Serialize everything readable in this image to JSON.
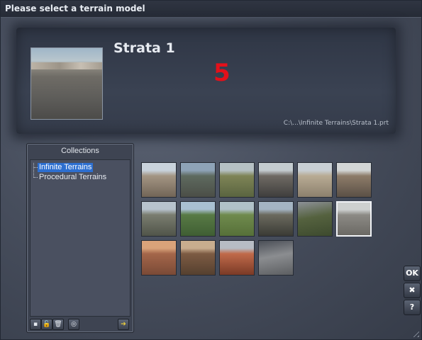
{
  "window": {
    "title": "Please select a terrain model"
  },
  "preview": {
    "name": "Strata 1",
    "count": "5",
    "path": "C:\\...\\Infinite Terrains\\Strata 1.prt"
  },
  "collections": {
    "header": "Collections",
    "items": [
      {
        "label": "Infinite Terrains",
        "selected": true
      },
      {
        "label": "Procedural Terrains",
        "selected": false
      }
    ],
    "toolbar": [
      {
        "name": "new-collection-button",
        "icon": "page-icon",
        "glyph": "▪"
      },
      {
        "name": "lock-collection-button",
        "icon": "lock-icon",
        "glyph": "🔓"
      },
      {
        "name": "delete-collection-button",
        "icon": "trash-icon",
        "glyph": "🗑"
      },
      {
        "name": "browse-collection-button",
        "icon": "globe-icon",
        "glyph": "◎"
      },
      {
        "name": "go-collection-button",
        "icon": "arrow-right-icon",
        "glyph": "➔"
      }
    ]
  },
  "terrains": [
    {
      "colors": [
        "#c9d3dc",
        "#a39583",
        "#726557"
      ]
    },
    {
      "colors": [
        "#8ea3b7",
        "#5e6a5f",
        "#4b4e47"
      ]
    },
    {
      "colors": [
        "#b6c1c4",
        "#7e8456",
        "#5a6440"
      ]
    },
    {
      "colors": [
        "#c4ccd0",
        "#6f6a63",
        "#3f3e3d"
      ]
    },
    {
      "colors": [
        "#c8cfd4",
        "#b8ab94",
        "#8c806d"
      ]
    },
    {
      "colors": [
        "#d3d6d6",
        "#8d7c69",
        "#5b5046"
      ]
    },
    {
      "colors": [
        "#b7c3cd",
        "#7a7d70",
        "#505449"
      ]
    },
    {
      "colors": [
        "#a9c0d2",
        "#587a45",
        "#3f5e33"
      ]
    },
    {
      "colors": [
        "#b0c1c8",
        "#6f8a4d",
        "#567039"
      ]
    },
    {
      "colors": [
        "#a4b4c3",
        "#6b6a5e",
        "#3a3a35"
      ]
    },
    {
      "colors": [
        "#8d9198",
        "#55623f",
        "#3d4a2e"
      ],
      "dark": true
    },
    {
      "colors": [
        "#cdd0cf",
        "#8c8a85",
        "#6b6964"
      ],
      "selected": true
    },
    {
      "colors": [
        "#d9a37a",
        "#a4664a",
        "#7a4a36"
      ]
    },
    {
      "colors": [
        "#c8ad8e",
        "#7d5b43",
        "#55402f"
      ]
    },
    {
      "colors": [
        "#b7bcc4",
        "#c06a4a",
        "#7a3a26"
      ]
    },
    {
      "colors": [
        "#4b4f57",
        "#8b8d90",
        "#5c5e61"
      ],
      "dark": true
    }
  ],
  "buttons": {
    "ok": "OK",
    "cancel": "✖",
    "help": "?"
  }
}
